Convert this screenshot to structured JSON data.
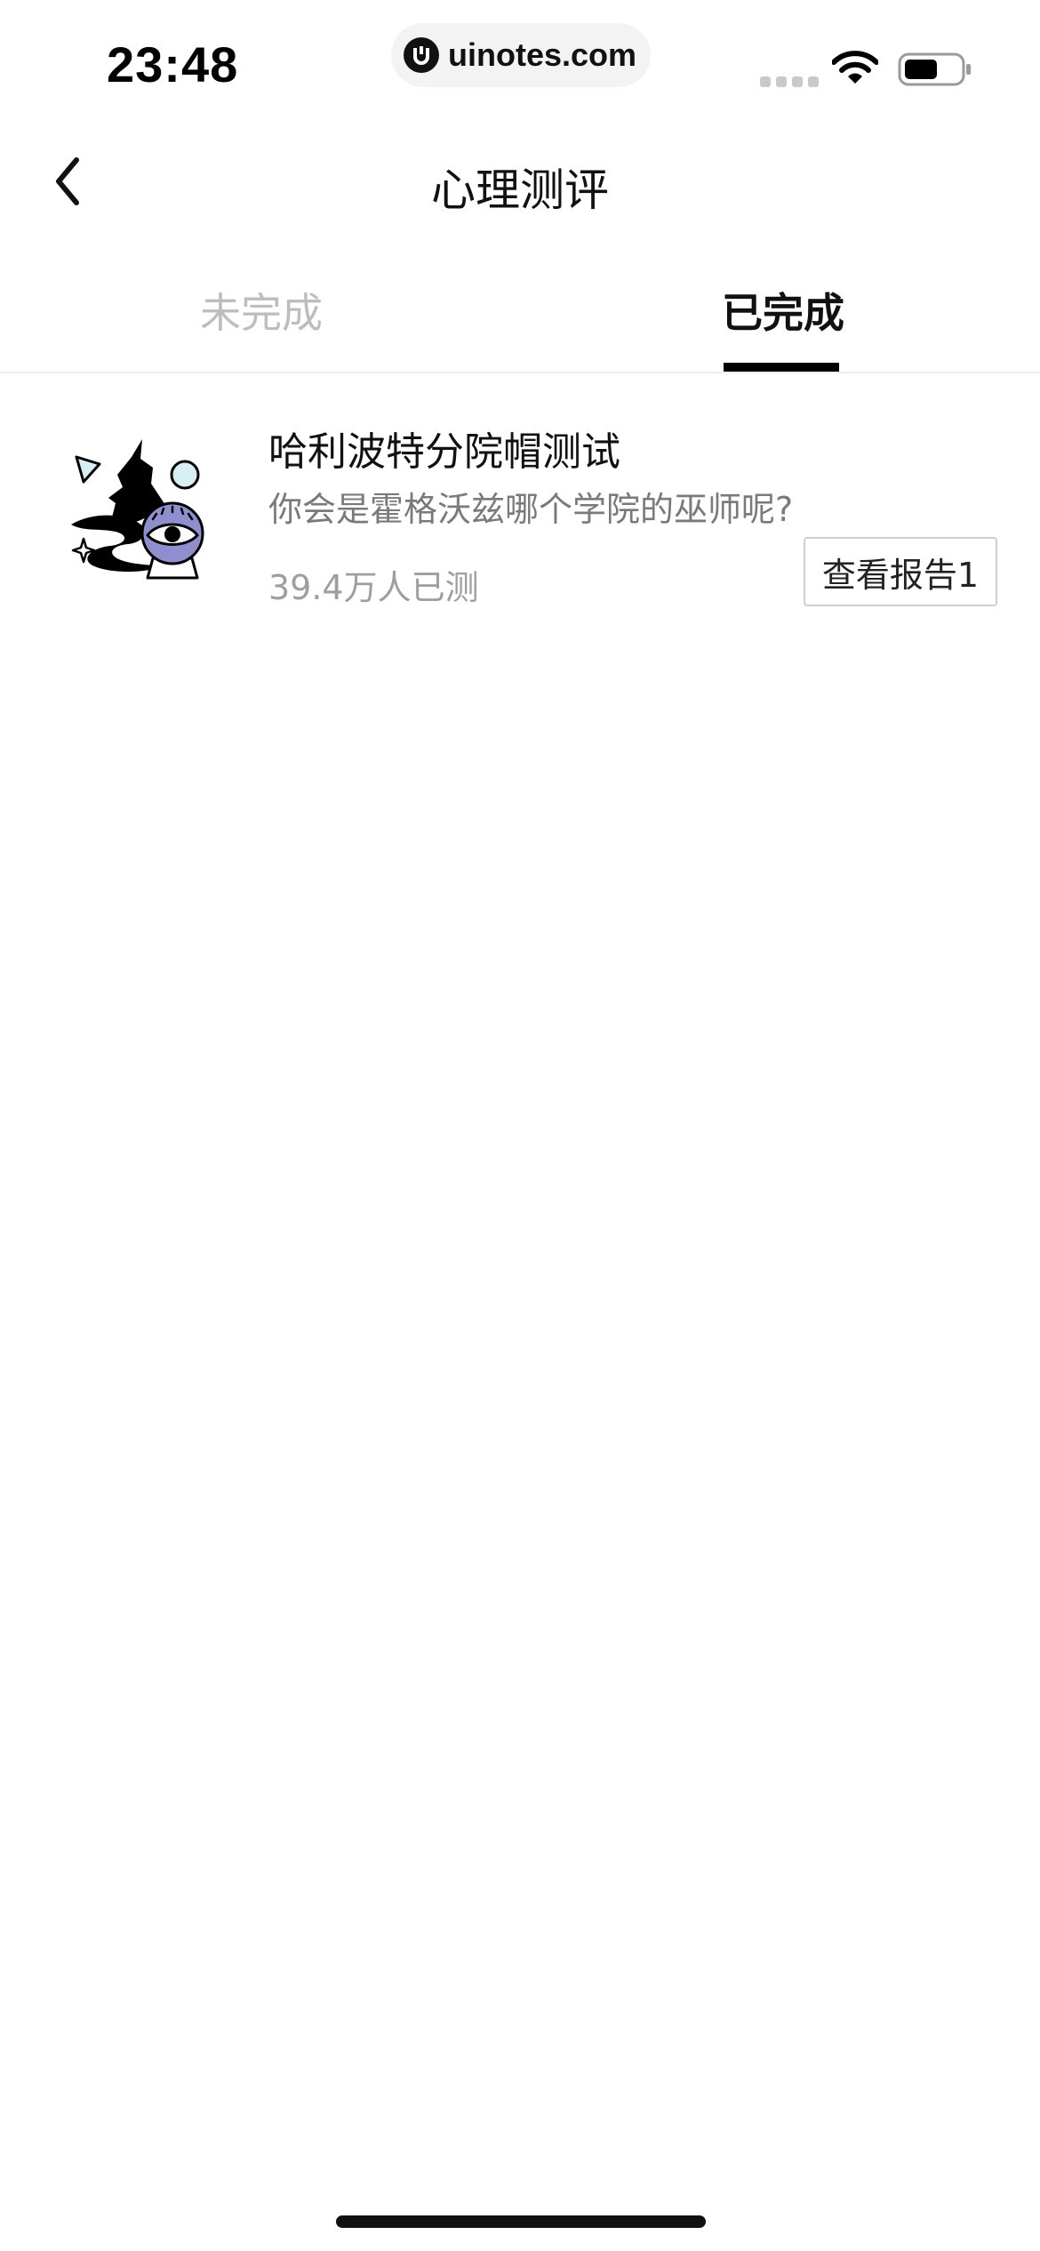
{
  "status_bar": {
    "time": "23:48",
    "url": "uinotes.com"
  },
  "nav": {
    "title": "心理测评"
  },
  "tabs": [
    {
      "label": "未完成",
      "active": false
    },
    {
      "label": "已完成",
      "active": true
    }
  ],
  "tests": [
    {
      "title": "哈利波特分院帽测试",
      "description": "你会是霍格沃兹哪个学院的巫师呢?",
      "count": "39.4万人已测",
      "report_label": "查看报告1",
      "image_icon": "wizard-hat-crystal-ball-icon"
    }
  ],
  "colors": {
    "active_tab": "#111111",
    "inactive_tab": "#bdbdbd",
    "illustration_accent": "#8f8fd0",
    "illustration_light": "#d8eef3"
  }
}
